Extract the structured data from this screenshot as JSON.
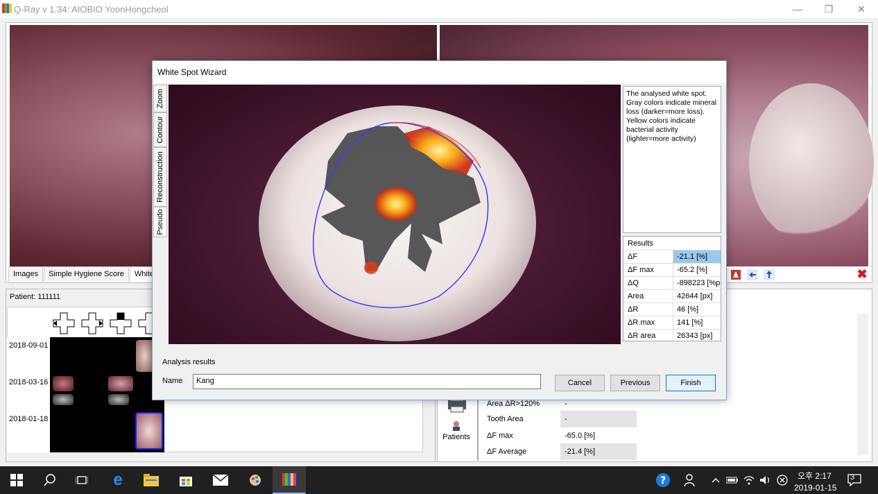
{
  "window": {
    "title": "Q-Ray v 1.34: AIOBIO YoonHongcheol",
    "min": "—",
    "max": "❐",
    "close": "✕"
  },
  "tabs": [
    "Images",
    "Simple Hygiene Score",
    "White Sp"
  ],
  "patient": {
    "label": "Patient: 111111",
    "dates": [
      "2018-09-01",
      "2018-03-16",
      "2018-01-18"
    ]
  },
  "stats_table": [
    {
      "key": "Area ΔR>120%",
      "value": "-"
    },
    {
      "key": "Tooth Area",
      "value": "-"
    },
    {
      "key": "ΔF max",
      "value": "-65.0 [%]"
    },
    {
      "key": "ΔF Average",
      "value": "-21.4 [%]"
    }
  ],
  "patients_button": "Patients",
  "dialog": {
    "title": "White Spot Wizard",
    "side_tabs": [
      "Zoom",
      "Contour",
      "Reconstruction",
      "Pseudo"
    ],
    "description": "The analysed white spot. Gray colors indicate mineral loss (darker=more loss). Yellow colors indicate bacterial activity (lighter=more activity)",
    "results_header": "Results",
    "results": [
      {
        "key": "ΔF",
        "value": "-21.1 [%]"
      },
      {
        "key": "ΔF max",
        "value": "-65.2 [%]"
      },
      {
        "key": "ΔQ",
        "value": "-898223 [%p"
      },
      {
        "key": "Area",
        "value": "42644 [px]"
      },
      {
        "key": "ΔR",
        "value": "46 [%]"
      },
      {
        "key": "ΔR max",
        "value": "141 [%]"
      },
      {
        "key": "ΔR area",
        "value": "26343 [px]"
      }
    ],
    "analysis_label": "Analysis results",
    "name_label": "Name",
    "name_value": "Kang",
    "buttons": {
      "cancel": "Cancel",
      "previous": "Previous",
      "finish": "Finish"
    }
  },
  "taskbar": {
    "time": "오후 2:17",
    "date": "2019-01-15",
    "notifications": "3"
  }
}
